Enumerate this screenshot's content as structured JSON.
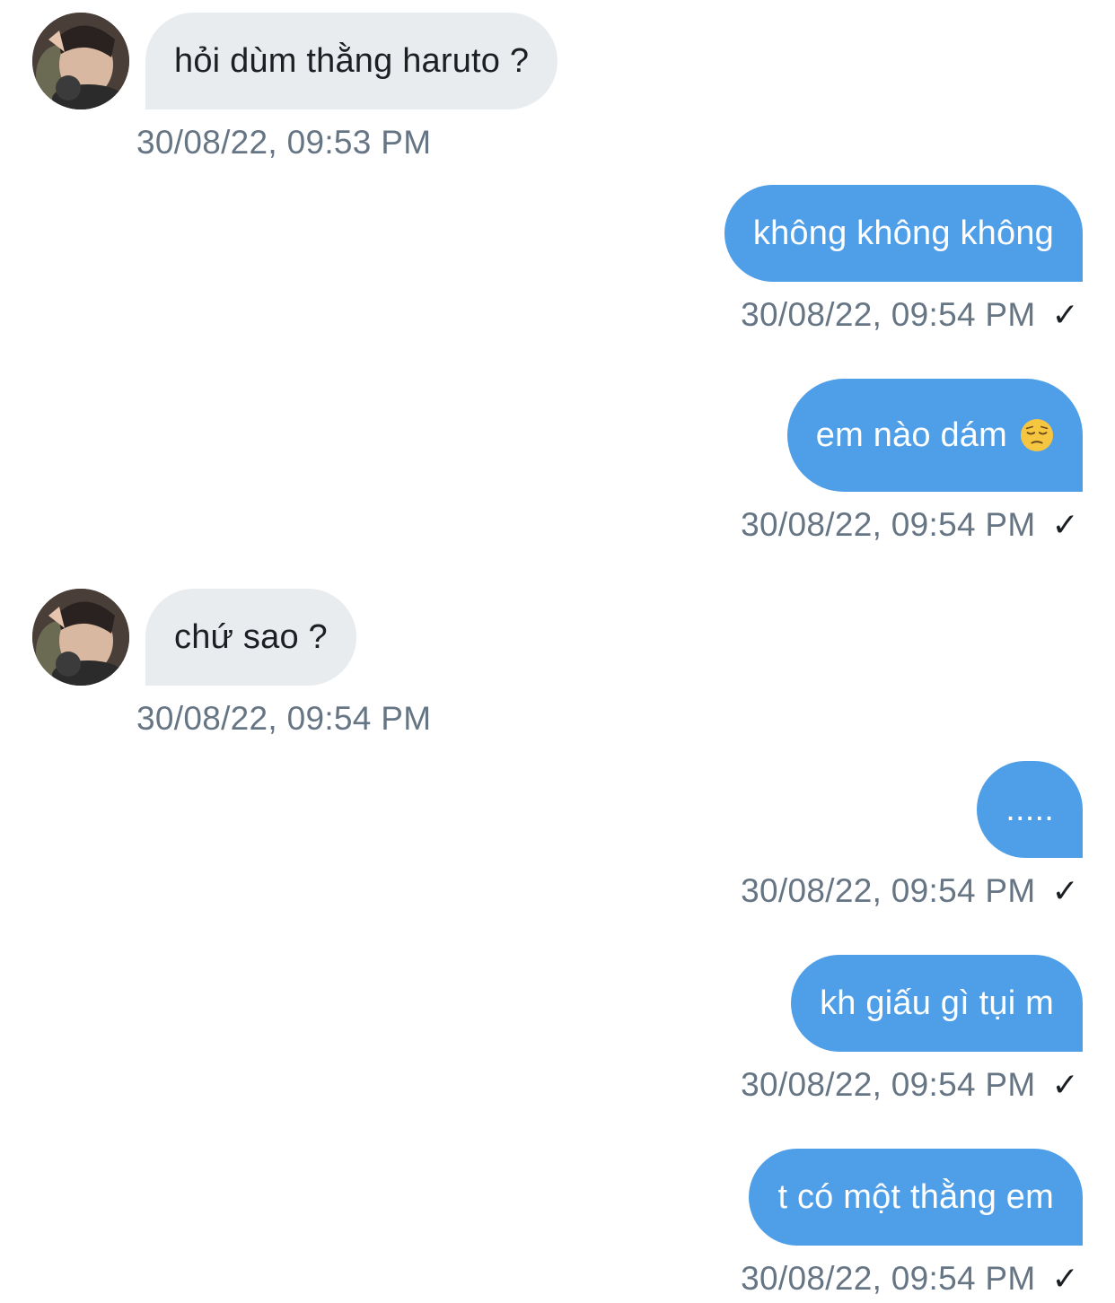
{
  "messages": [
    {
      "direction": "incoming",
      "text": "hỏi dùm thằng haruto ?",
      "time": "30/08/22, 09:53 PM"
    },
    {
      "direction": "outgoing",
      "text": "không không không",
      "time": "30/08/22, 09:54 PM",
      "status": "✓"
    },
    {
      "direction": "outgoing",
      "text": "em nào dám",
      "emoji": "pensive-face",
      "time": "30/08/22, 09:54 PM",
      "status": "✓"
    },
    {
      "direction": "incoming",
      "text": "chứ sao ?",
      "time": "30/08/22, 09:54 PM"
    },
    {
      "direction": "outgoing",
      "text": ".....",
      "time": "30/08/22, 09:54 PM",
      "status": "✓"
    },
    {
      "direction": "outgoing",
      "text": "kh giấu gì tụi m",
      "time": "30/08/22, 09:54 PM",
      "status": "✓"
    },
    {
      "direction": "outgoing",
      "text": "t có một thằng em",
      "time": "30/08/22, 09:54 PM",
      "status": "✓"
    }
  ],
  "colors": {
    "incoming_bubble": "#e9ecef",
    "outgoing_bubble": "#4f9ee8",
    "timestamp": "#667584"
  }
}
